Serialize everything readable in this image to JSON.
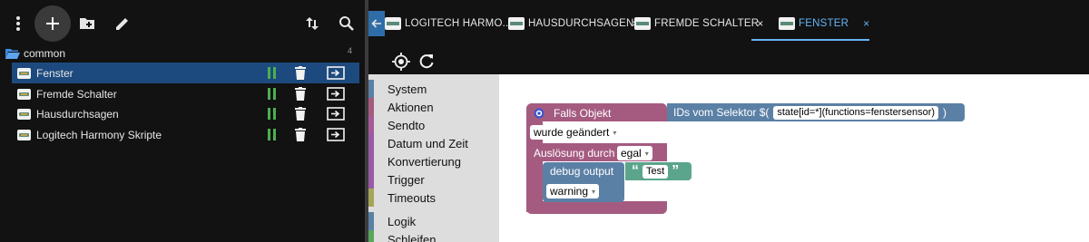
{
  "left_toolbar": {
    "icons": [
      "more-vert-icon",
      "add-icon",
      "add-folder-icon",
      "edit-icon",
      "sort-icon",
      "search-icon"
    ]
  },
  "folder": {
    "label": "common",
    "count": "4"
  },
  "scripts": [
    {
      "label": "Fenster",
      "selected": true
    },
    {
      "label": "Fremde Schalter",
      "selected": false
    },
    {
      "label": "Hausdurchsagen",
      "selected": false
    },
    {
      "label": "Logitech Harmony Skripte",
      "selected": false
    }
  ],
  "tabs": [
    {
      "label": "LOGITECH HARMO...",
      "close": "×",
      "active": false
    },
    {
      "label": "HAUSDURCHSAGEN",
      "close": "×",
      "active": false
    },
    {
      "label": "FREMDE SCHALTER",
      "close": "×",
      "active": false
    },
    {
      "label": "FENSTER",
      "close": "×",
      "active": true
    }
  ],
  "categories": [
    {
      "label": "System",
      "color": "#5b80a5"
    },
    {
      "label": "Aktionen",
      "color": "#a55b80"
    },
    {
      "label": "Sendto",
      "color": "#a55b99"
    },
    {
      "label": "Datum und Zeit",
      "color": "#995ba5"
    },
    {
      "label": "Konvertierung",
      "color": "#995ba5"
    },
    {
      "label": "Trigger",
      "color": "#995ba5"
    },
    {
      "label": "Timeouts",
      "color": "#a5a55b"
    },
    {
      "label": "Logik",
      "color": "#5b80a5"
    },
    {
      "label": "Schleifen",
      "color": "#5ba55b"
    }
  ],
  "blocks": {
    "trigger": {
      "title": "Falls Objekt",
      "event_value": "wurde geändert",
      "source_label": "Auslösung durch",
      "source_value": "egal",
      "color": "#a55b80"
    },
    "selector": {
      "label": "IDs vom Selektor $(",
      "value": "state[id=*](functions=fenstersensor)",
      "close": ")",
      "color": "#5b80a5"
    },
    "debug": {
      "label": "debug output",
      "level_value": "warning",
      "color": "#5b80a5"
    },
    "text": {
      "open_quote": "“",
      "value": "Test",
      "close_quote": "”",
      "color": "#5ba58c"
    }
  }
}
